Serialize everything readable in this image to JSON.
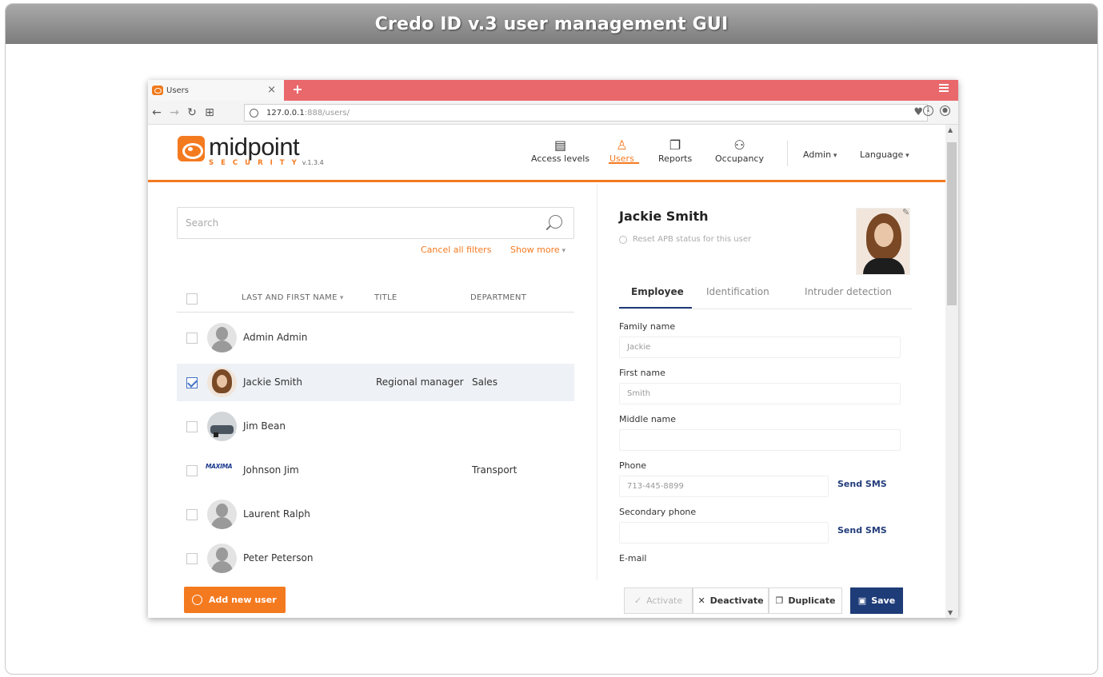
{
  "frame": {
    "title": "Credo ID v.3 user management GUI"
  },
  "browser": {
    "tab_title": "Users",
    "tab_close": "×",
    "new_tab": "+",
    "url_host": "127.0.0.1",
    "url_rest": ":888/users/"
  },
  "nav": {
    "logo_word": "midpoint",
    "logo_security": "SECURITY",
    "version": "v.1.3.4",
    "items": [
      {
        "label": "Access levels",
        "icon": "access-levels-icon"
      },
      {
        "label": "Users",
        "icon": "users-icon",
        "active": true
      },
      {
        "label": "Reports",
        "icon": "reports-icon"
      },
      {
        "label": "Occupancy",
        "icon": "occupancy-icon"
      }
    ],
    "admin": "Admin",
    "language": "Language"
  },
  "list": {
    "search_placeholder": "Search",
    "cancel_filters": "Cancel all filters",
    "show_more": "Show more",
    "columns": [
      "LAST AND FIRST NAME",
      "TITLE",
      "DEPARTMENT"
    ],
    "rows": [
      {
        "name": "Admin Admin",
        "title": "",
        "department": "",
        "avatar": "generic",
        "checked": false
      },
      {
        "name": "Jackie Smith",
        "title": "Regional manager",
        "department": "Sales",
        "avatar": "photo",
        "checked": true
      },
      {
        "name": "Jim Bean",
        "title": "",
        "department": "",
        "avatar": "car",
        "checked": false
      },
      {
        "name": "Johnson Jim",
        "title": "",
        "department": "Transport",
        "avatar": "logo",
        "avatar_text": "MAXIMA",
        "checked": false
      },
      {
        "name": "Laurent Ralph",
        "title": "",
        "department": "",
        "avatar": "generic",
        "checked": false
      },
      {
        "name": "Peter Peterson",
        "title": "",
        "department": "",
        "avatar": "generic",
        "checked": false
      }
    ],
    "add_user": "Add new user"
  },
  "detail": {
    "name": "Jackie Smith",
    "reset_apb": "Reset APB status for this user",
    "tabs": [
      "Employee",
      "Identification",
      "Intruder detection"
    ],
    "fields": {
      "family_name_label": "Family name",
      "family_name_value": "Jackie",
      "first_name_label": "First name",
      "first_name_value": "Smith",
      "middle_name_label": "Middle name",
      "middle_name_value": "",
      "phone_label": "Phone",
      "phone_value": "713-445-8899",
      "secondary_phone_label": "Secondary phone",
      "secondary_phone_value": "",
      "email_label": "E-mail",
      "send_sms": "Send SMS"
    },
    "actions": {
      "activate": "Activate",
      "deactivate": "Deactivate",
      "duplicate": "Duplicate",
      "save": "Save"
    }
  },
  "colors": {
    "accent": "#f47a20",
    "navy": "#1e3c78",
    "tabbar": "#e9686c"
  }
}
